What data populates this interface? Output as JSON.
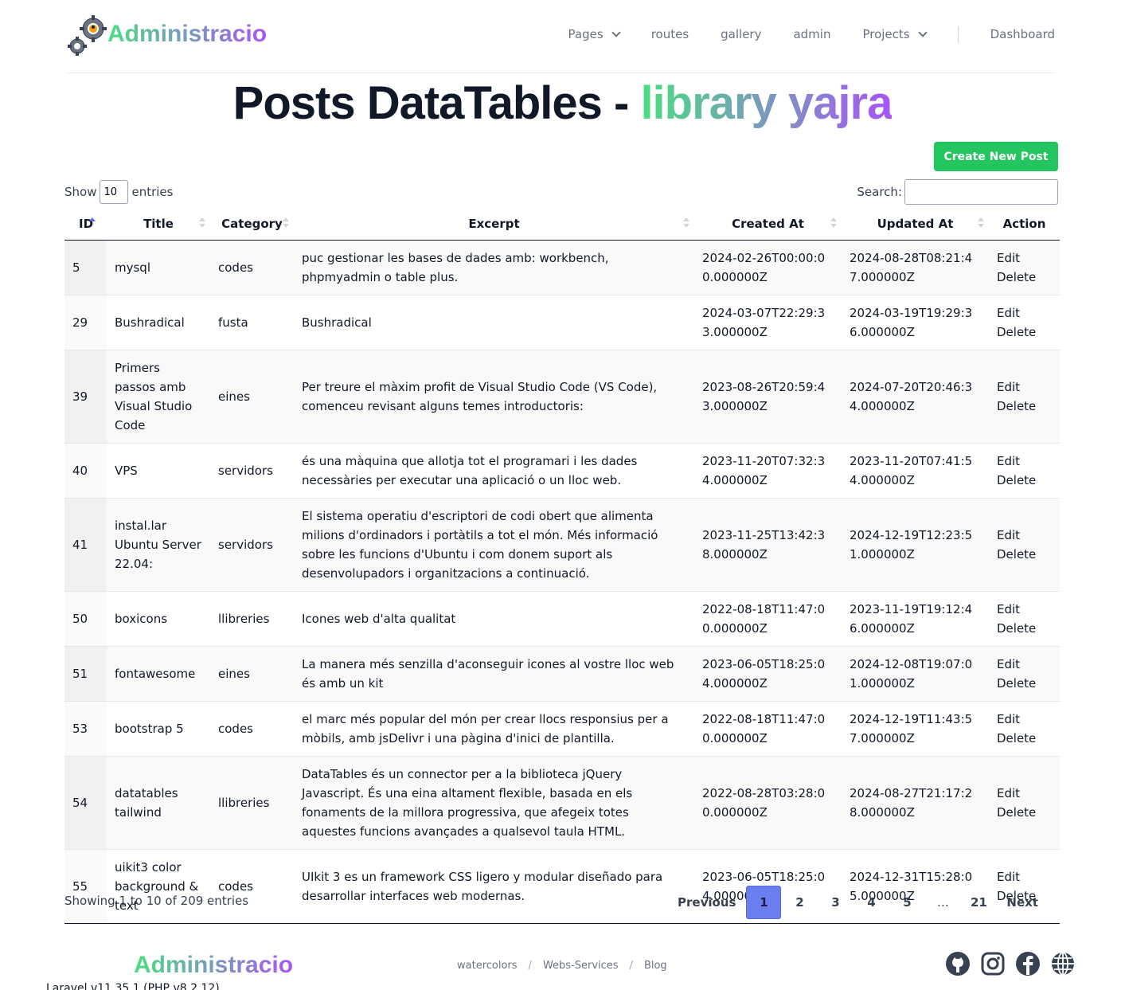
{
  "brand": {
    "name": "Administracio"
  },
  "nav": {
    "pages": "Pages",
    "routes": "routes",
    "gallery": "gallery",
    "admin": "admin",
    "projects": "Projects",
    "dashboard": "Dashboard"
  },
  "title": {
    "main": "Posts DataTables - ",
    "highlight": "library yajra"
  },
  "create_button": "Create New Post",
  "controls": {
    "show_label": "Show",
    "entries_value": "10",
    "entries_label": "entries",
    "search_label": "Search:",
    "search_value": ""
  },
  "table": {
    "headers": [
      "ID",
      "Title",
      "Category",
      "Excerpt",
      "Created At",
      "Updated At",
      "Action"
    ],
    "edit_label": "Edit",
    "delete_label": "Delete",
    "rows": [
      {
        "id": "5",
        "title": "mysql",
        "category": "codes",
        "excerpt": "puc gestionar les bases de dades amb: workbench, phpmyadmin o table plus.",
        "created": "2024-02-26T00:00:00.000000Z",
        "updated": "2024-08-28T08:21:47.000000Z"
      },
      {
        "id": "29",
        "title": "Bushradical",
        "category": "fusta",
        "excerpt": "Bushradical",
        "created": "2024-03-07T22:29:33.000000Z",
        "updated": "2024-03-19T19:29:36.000000Z"
      },
      {
        "id": "39",
        "title": "Primers passos amb Visual Studio Code",
        "category": "eines",
        "excerpt": "Per treure el màxim profit de Visual Studio Code (VS Code), comenceu revisant alguns temes introductoris:",
        "created": "2023-08-26T20:59:43.000000Z",
        "updated": "2024-07-20T20:46:34.000000Z"
      },
      {
        "id": "40",
        "title": "VPS",
        "category": "servidors",
        "excerpt": "és una màquina que allotja tot el programari i les dades necessàries per executar una aplicació o un lloc web.",
        "created": "2023-11-20T07:32:34.000000Z",
        "updated": "2023-11-20T07:41:54.000000Z"
      },
      {
        "id": "41",
        "title": "instal.lar Ubuntu Server 22.04:",
        "category": "servidors",
        "excerpt": "El sistema operatiu d'escriptori de codi obert que alimenta milions d'ordinadors i portàtils a tot el món. Més informació sobre les funcions d'Ubuntu i com donem suport als desenvolupadors i organitzacions a continuació.",
        "created": "2023-11-25T13:42:38.000000Z",
        "updated": "2024-12-19T12:23:51.000000Z"
      },
      {
        "id": "50",
        "title": "boxicons",
        "category": "llibreries",
        "excerpt": "Icones web d'alta qualitat",
        "created": "2022-08-18T11:47:00.000000Z",
        "updated": "2023-11-19T19:12:46.000000Z"
      },
      {
        "id": "51",
        "title": "fontawesome",
        "category": "eines",
        "excerpt": "La manera més senzilla d'aconseguir icones al vostre lloc web és amb un kit",
        "created": "2023-06-05T18:25:04.000000Z",
        "updated": "2024-12-08T19:07:01.000000Z"
      },
      {
        "id": "53",
        "title": "bootstrap 5",
        "category": "codes",
        "excerpt": "el marc més popular del món per crear llocs responsius per a mòbils, amb jsDelivr i una pàgina d'inici de plantilla.",
        "created": "2022-08-18T11:47:00.000000Z",
        "updated": "2024-12-19T11:43:57.000000Z"
      },
      {
        "id": "54",
        "title": "datatables tailwind",
        "category": "llibreries",
        "excerpt": "DataTables és un connector per a la biblioteca jQuery Javascript. És una eina altament flexible, basada en els fonaments de la millora progressiva, que afegeix totes aquestes funcions avançades a qualsevol taula HTML.",
        "created": "2022-08-28T03:28:00.000000Z",
        "updated": "2024-08-27T21:17:28.000000Z"
      },
      {
        "id": "55",
        "title": "uikit3 color background & text",
        "category": "codes",
        "excerpt": "UIkit 3 es un framework CSS ligero y modular diseñado para desarrollar interfaces web modernas.",
        "created": "2023-06-05T18:25:04.000000Z",
        "updated": "2024-12-31T15:28:05.000000Z"
      }
    ]
  },
  "info": "Showing 1 to 10 of 209 entries",
  "pagination": {
    "previous": "Previous",
    "pages": [
      "1",
      "2",
      "3",
      "4",
      "5",
      "…",
      "21"
    ],
    "current": "1",
    "next": "Next"
  },
  "footer": {
    "brand": "Administracio",
    "links": [
      "watercolors",
      "Webs-Services",
      "Blog"
    ],
    "link_separator": "/",
    "icons": [
      "github-icon",
      "instagram-icon",
      "facebook-icon",
      "globe-icon"
    ],
    "version": "Laravel v11.35.1 (PHP v8.2.12)"
  },
  "colors": {
    "accent_green": "#22c55e",
    "gradient_start": "#4ade80",
    "gradient_end": "#a855f7",
    "page_current": "#6b7ef0"
  }
}
